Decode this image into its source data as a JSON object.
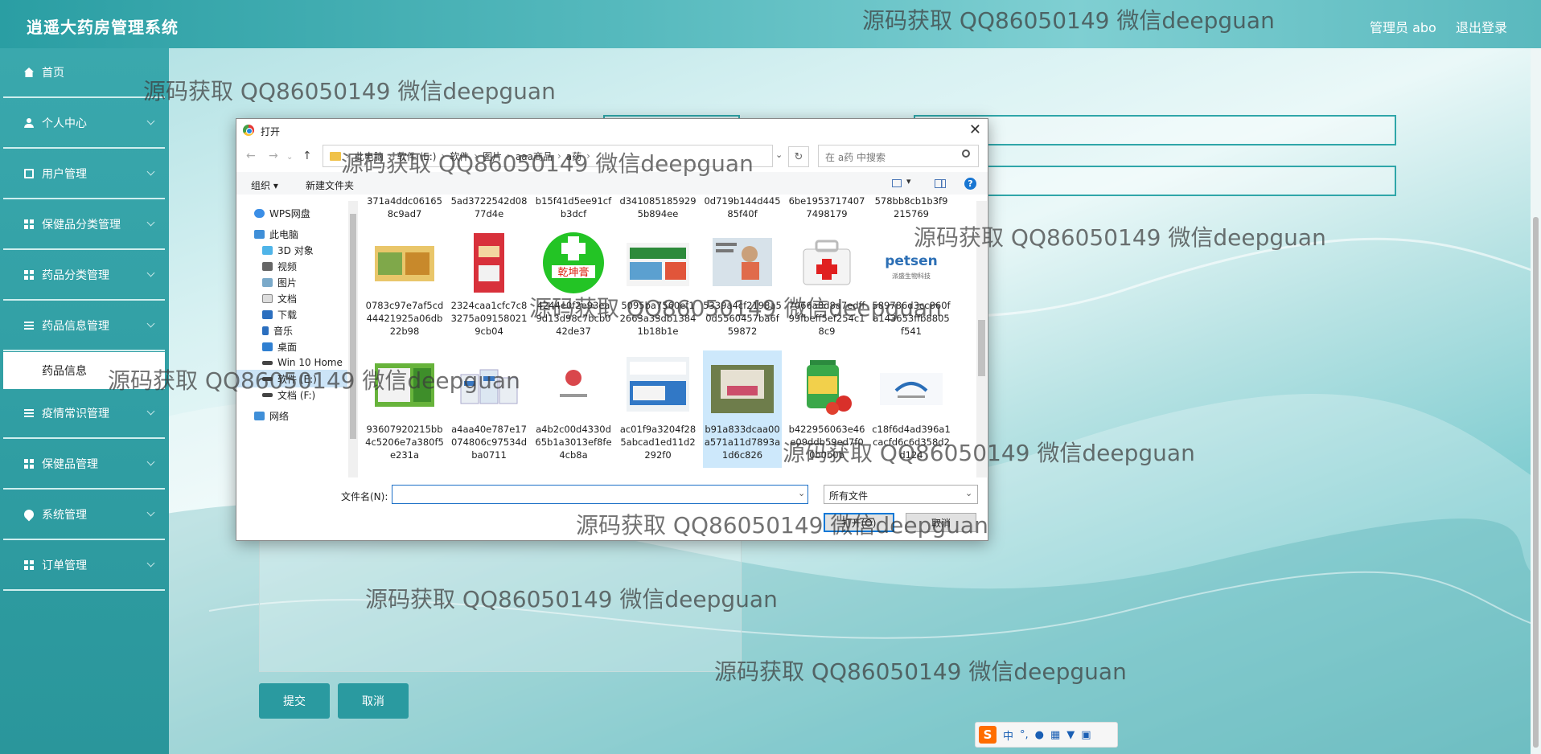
{
  "app": {
    "title": "逍遥大药房管理系统",
    "admin_label": "管理员 abo",
    "logout": "退出登录"
  },
  "sidebar": {
    "items": [
      {
        "label": "首页",
        "icon": "home-icon"
      },
      {
        "label": "个人中心",
        "icon": "user-icon"
      },
      {
        "label": "用户管理",
        "icon": "document-icon"
      },
      {
        "label": "保健品分类管理",
        "icon": "grid-icon"
      },
      {
        "label": "药品分类管理",
        "icon": "grid-icon"
      },
      {
        "label": "药品信息管理",
        "icon": "list-icon"
      },
      {
        "label": "疫情常识管理",
        "icon": "list-icon"
      },
      {
        "label": "保健品管理",
        "icon": "grid-icon"
      },
      {
        "label": "系统管理",
        "icon": "pin-icon"
      },
      {
        "label": "订单管理",
        "icon": "grid-icon"
      }
    ],
    "sub_item": "药品信息"
  },
  "form": {
    "submit": "提交",
    "cancel": "取消"
  },
  "dialog": {
    "title": "打开",
    "breadcrumb": [
      "此电脑",
      "软件 (E:)",
      "软件",
      "图片",
      "aaa商品",
      "a药"
    ],
    "search_placeholder": "在 a药 中搜索",
    "organize": "组织 ▾",
    "new_folder": "新建文件夹",
    "help": "?",
    "tree": [
      "WPS网盘",
      "此电脑",
      "3D 对象",
      "视频",
      "图片",
      "文档",
      "下载",
      "音乐",
      "桌面",
      "Win 10 Home",
      "软件 (E:)",
      "文档 (F:)",
      "网络"
    ],
    "top_row": [
      "371a4ddc061658c9ad7",
      "5ad3722542d0877d4e",
      "b15f41d5ee91cfb3dcf",
      "d3410851859295b894ee",
      "0d719b144d44585f40f",
      "6be19537174077498179",
      "578bb8cb1b3f9215769"
    ],
    "files_row1": [
      "0783c97e7af5cd44421925a06db22b98",
      "2324caa1cfc7c83275a091580219cb04",
      "4244e0f2e93ea9d13d98c7bcb042de37",
      "5095ba7560ef12663a33db13841b18b1e",
      "5339a4cf2198a50d5560457ba6f59872",
      "7066a8d8a7edff99fbeff5ef254c18c9",
      "589786d3cc860fa143653ffb8805f541"
    ],
    "files_row2": [
      "93607920215bb4c5206e7a380f5e231a",
      "a4aa40e787e17074806c97534dba0711",
      "a4b2c00d4330d65b1a3013ef8fe4cb8a",
      "ac01f9a3204f285abcad1ed11d2292f0",
      "b91a833dcaa00a571a11d7893a1d6c826",
      "b422956063e46e09ddb59ed7f00b0b0b",
      "c18f6d4ad396a1cacfd6c6d358d2d124"
    ],
    "thumb_texts": {
      "pk": "乾坤膏",
      "petsen": "petsen",
      "petsen_sub": "派盛生物科技"
    },
    "filename_label": "文件名(N):",
    "filename_value": "",
    "filter": "所有文件",
    "open_btn": "打开(O)",
    "cancel_btn": "取消"
  },
  "ime": {
    "logo": "S",
    "mode": "中",
    "punct": "°,"
  },
  "watermark": "源码获取 QQ86050149 微信deepguan",
  "colors": {
    "accent": "#2a9aa0",
    "topbar": "#55b9bd"
  }
}
